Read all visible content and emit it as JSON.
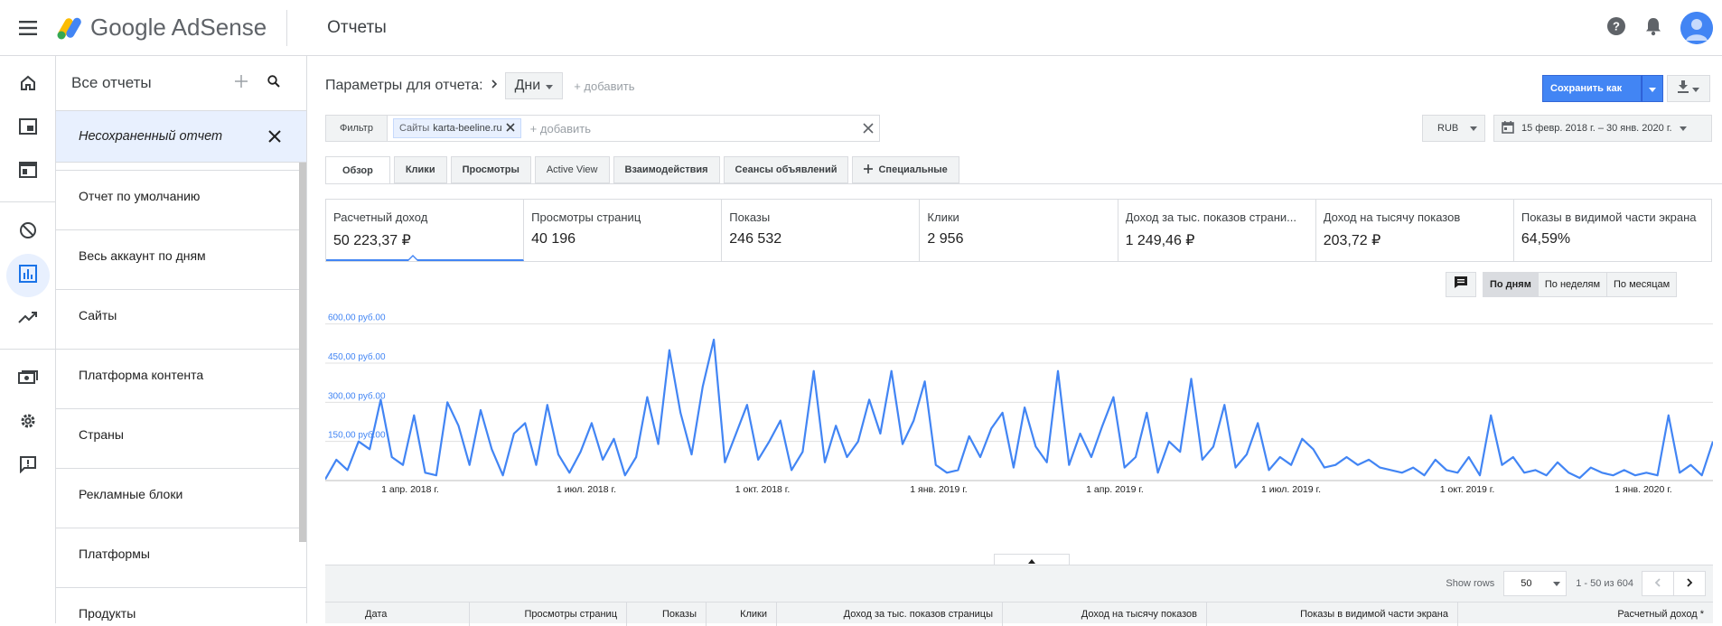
{
  "app": {
    "brand": "Google AdSense",
    "section_title": "Отчеты",
    "icons": {
      "menu": "menu-icon",
      "help": "help-icon",
      "notifications": "bell-icon",
      "account": "avatar"
    }
  },
  "rail": {
    "items": [
      {
        "icon": "home-icon"
      },
      {
        "icon": "ads-icon"
      },
      {
        "icon": "sites-icon"
      },
      {
        "icon": "block-icon"
      },
      {
        "icon": "reports-icon"
      },
      {
        "icon": "optimization-icon"
      },
      {
        "icon": "payments-icon"
      },
      {
        "icon": "settings-icon"
      },
      {
        "icon": "feedback-icon"
      }
    ]
  },
  "reports": {
    "title": "Все отчеты",
    "unsaved": "Несохраненный отчет",
    "items": [
      "Отчет по умолчанию",
      "Весь аккаунт по дням",
      "Сайты",
      "Платформа контента",
      "Страны",
      "Рекламные блоки",
      "Платформы",
      "Продукты"
    ]
  },
  "params": {
    "label": "Параметры для отчета:",
    "dimension": "Дни",
    "add": "+ добавить"
  },
  "toolbar": {
    "save_label": "Сохранить как",
    "currency": "RUB",
    "date_range": "15 февр. 2018 г. – 30 янв. 2020 г."
  },
  "filter": {
    "label": "Фильтр",
    "chip_dimension": "Сайты",
    "chip_value": "karta-beeline.ru",
    "add_placeholder": "+ добавить"
  },
  "tabs": [
    "Обзор",
    "Клики",
    "Просмотры",
    "Active View",
    "Взаимодействия",
    "Сеансы объявлений",
    "Специальные"
  ],
  "metrics": [
    {
      "label": "Расчетный доход",
      "value": "50 223,37 ₽"
    },
    {
      "label": "Просмотры страниц",
      "value": "40 196"
    },
    {
      "label": "Показы",
      "value": "246 532"
    },
    {
      "label": "Клики",
      "value": "2 956"
    },
    {
      "label": "Доход за тыс. показов страни...",
      "value": "1 249,46 ₽"
    },
    {
      "label": "Доход на тысячу показов",
      "value": "203,72 ₽"
    },
    {
      "label": "Показы в видимой части экрана",
      "value": "64,59%"
    }
  ],
  "granularity": [
    "По дням",
    "По неделям",
    "По месяцам"
  ],
  "chart_data": {
    "type": "line",
    "series": [
      {
        "values": [
          5,
          80,
          40,
          150,
          120,
          310,
          90,
          60,
          250,
          30,
          20,
          300,
          210,
          60,
          270,
          120,
          20,
          180,
          220,
          60,
          290,
          100,
          30,
          110,
          220,
          80,
          160,
          20,
          90,
          320,
          140,
          500,
          260,
          100,
          360,
          540,
          70,
          180,
          290,
          80,
          150,
          230,
          40,
          110,
          420,
          70,
          210,
          90,
          150,
          310,
          180,
          420,
          140,
          230,
          380,
          60,
          30,
          40,
          170,
          90,
          200,
          260,
          50,
          280,
          130,
          70,
          420,
          60,
          180,
          90,
          210,
          320,
          50,
          90,
          260,
          30,
          150,
          110,
          390,
          80,
          130,
          290,
          50,
          100,
          220,
          40,
          90,
          60,
          160,
          120,
          50,
          60,
          90,
          60,
          80,
          50,
          40,
          30,
          50,
          20,
          80,
          40,
          30,
          90,
          20,
          250,
          60,
          90,
          30,
          40,
          20,
          70,
          30,
          10,
          50,
          30,
          20,
          40,
          20,
          30,
          20,
          250,
          30,
          60,
          20,
          150
        ]
      }
    ],
    "y_ticks": [
      "600,00 руб.00",
      "450,00 руб.00",
      "300,00 руб.00",
      "150,00 руб.00"
    ],
    "x_ticks": [
      "1 апр. 2018 г.",
      "1 июл. 2018 г.",
      "1 окт. 2018 г.",
      "1 янв. 2019 г.",
      "1 апр. 2019 г.",
      "1 июл. 2019 г.",
      "1 окт. 2019 г.",
      "1 янв. 2020 г."
    ],
    "ylim": [
      0,
      630
    ],
    "color": "#4285f4",
    "grid": true
  },
  "table": {
    "show_rows_label": "Show rows",
    "rows_value": "50",
    "range_text": "1 - 50 из 604",
    "columns": [
      "Дата",
      "Просмотры страниц",
      "Показы",
      "Клики",
      "Доход за тыс. показов страницы",
      "Доход на тысячу показов",
      "Показы в видимой части экрана",
      "Расчетный доход *"
    ]
  }
}
